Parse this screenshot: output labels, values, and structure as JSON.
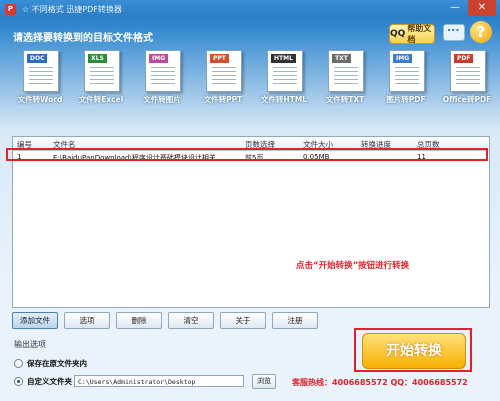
{
  "window": {
    "title": "☆ 不同格式   迅捷PDF转换器",
    "minimize": "—",
    "close": "✕"
  },
  "header": {
    "prompt": "请选择要转换到的目标文件格式",
    "help_label": "帮助文档",
    "help_prefix": "QQ"
  },
  "formats": [
    {
      "tag": "DOC",
      "label": "文件转Word",
      "color": "#2b6cc4",
      "icon": "word-doc-icon"
    },
    {
      "tag": "XLS",
      "label": "文件转Excel",
      "color": "#2e8b3a",
      "icon": "excel-doc-icon"
    },
    {
      "tag": "IMG",
      "label": "文件转图片",
      "color": "#c04a9a",
      "icon": "image-doc-icon"
    },
    {
      "tag": "PPT",
      "label": "文件转PPT",
      "color": "#d2502a",
      "icon": "ppt-doc-icon"
    },
    {
      "tag": "HTML",
      "label": "文件转HTML",
      "color": "#333333",
      "icon": "html-doc-icon"
    },
    {
      "tag": "TXT",
      "label": "文件转TXT",
      "color": "#6b6b6b",
      "icon": "txt-doc-icon"
    },
    {
      "tag": "IMG",
      "label": "图片转PDF",
      "color": "#3a7bd0",
      "icon": "image-to-pdf-icon"
    },
    {
      "tag": "PDF",
      "label": "Office转PDF",
      "color": "#c83a2c",
      "icon": "office-to-pdf-icon"
    }
  ],
  "table": {
    "headers": [
      "编号",
      "文件名",
      "页数选择",
      "文件大小",
      "转换进度",
      "总页数"
    ],
    "rows": [
      [
        "1",
        "E:\\BaiduPanDownload\\程序设计基础模块设计相关....",
        "前5页",
        "0.05MB",
        "",
        "11"
      ]
    ]
  },
  "hint": "点击“开始转换”按钮进行转换",
  "buttons": {
    "add": "添加文件",
    "options": "选项",
    "remove": "删除",
    "clear": "清空",
    "about": "关于",
    "register": "注册"
  },
  "output": {
    "label": "输出选项",
    "option_same": "保存在原文件夹内",
    "option_custom": "自定义文件夹",
    "path": "C:\\Users\\Administrator\\Desktop",
    "browse": "浏览"
  },
  "start_label": "开始转换",
  "hotline": "客服热线：4006685572 QQ：4006685572",
  "colors": {
    "accent": "#2d7fc7",
    "highlight_red": "#e0222a",
    "start_orange": "#f7b000"
  }
}
